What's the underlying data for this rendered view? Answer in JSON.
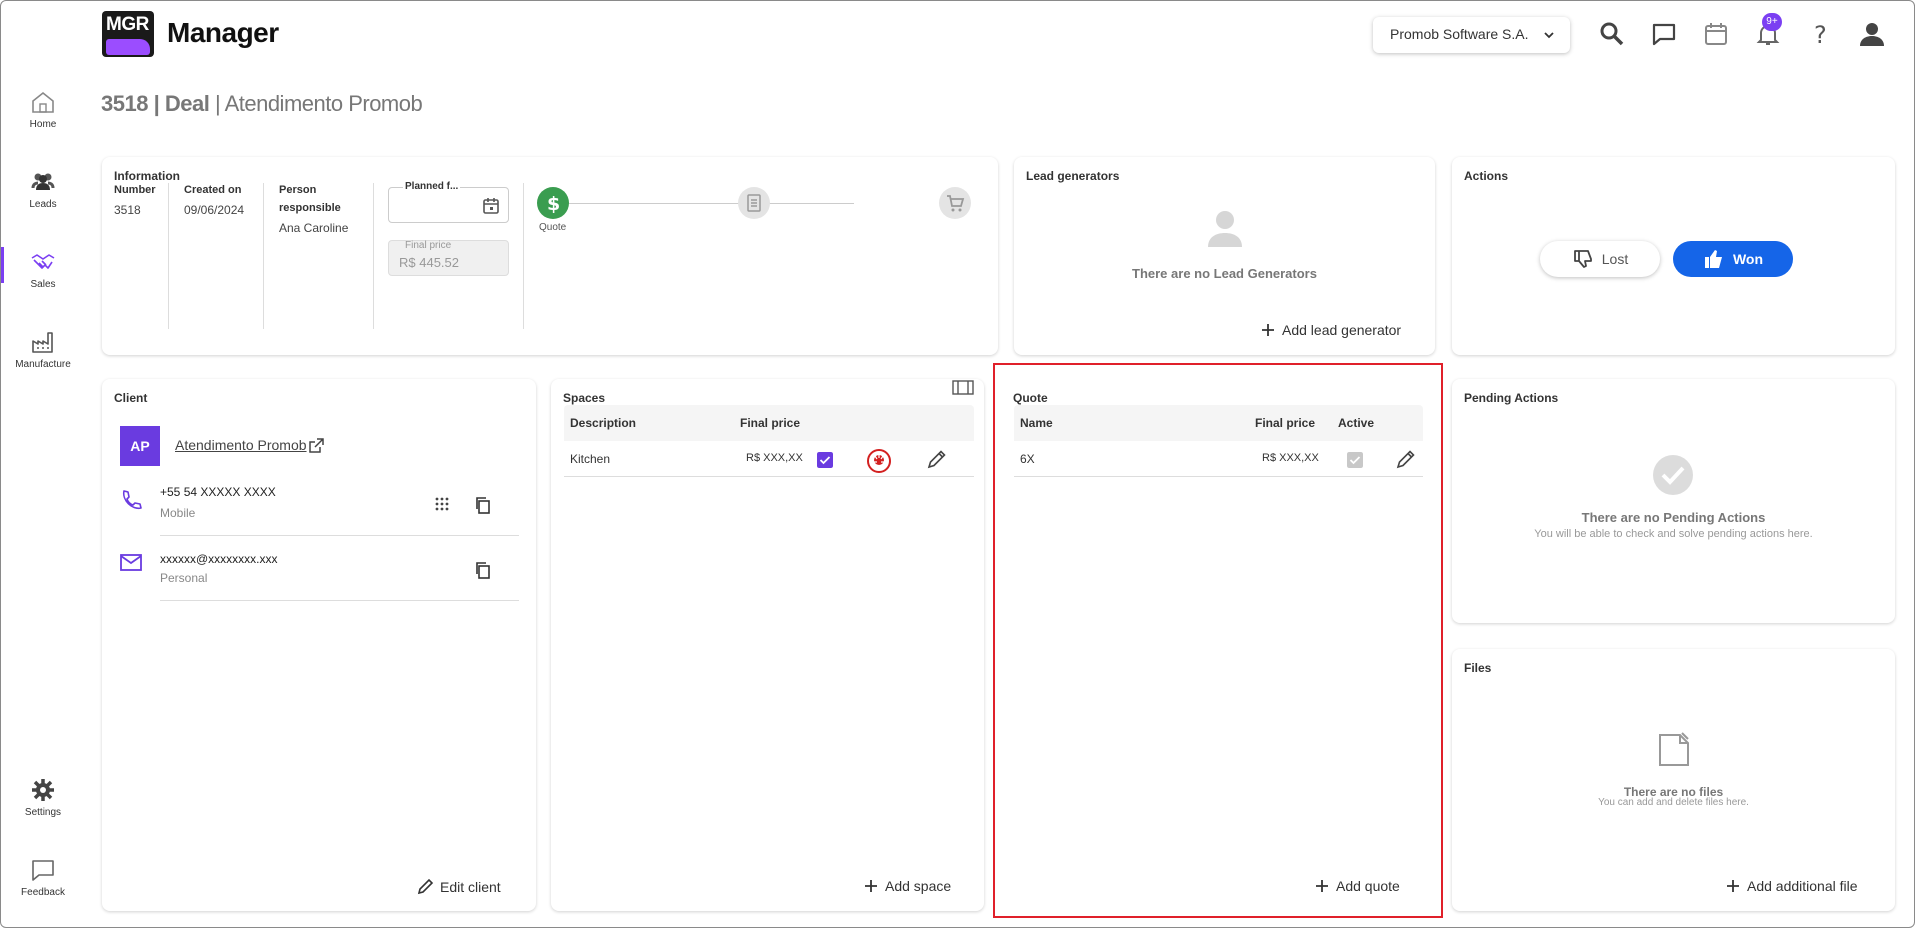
{
  "app": {
    "logo_text": "MGR",
    "title": "Manager"
  },
  "header": {
    "company": "Promob Software S.A.",
    "notification_count": "9+"
  },
  "nav": {
    "items": [
      {
        "label": "Home",
        "icon": "home-icon"
      },
      {
        "label": "Leads",
        "icon": "people-icon"
      },
      {
        "label": "Sales",
        "icon": "handshake-icon",
        "active": true
      },
      {
        "label": "Manufacture",
        "icon": "factory-icon"
      },
      {
        "label": "Settings",
        "icon": "gear-icon"
      },
      {
        "label": "Feedback",
        "icon": "feedback-icon"
      }
    ]
  },
  "page": {
    "number": "3518",
    "type": "Deal",
    "name": "Atendimento Promob"
  },
  "information": {
    "title": "Information",
    "number_label": "Number",
    "number": "3518",
    "created_label": "Created on",
    "created": "09/06/2024",
    "person_label": "Person responsible",
    "person": "Ana Caroline",
    "planned_label": "Planned f...",
    "final_price_label": "Final price",
    "final_price": "R$ 445.52",
    "steps": [
      {
        "label": "Quote",
        "icon": "dollar-icon",
        "done": true
      },
      {
        "label": "",
        "icon": "document-icon"
      },
      {
        "label": "",
        "icon": "cart-icon"
      }
    ]
  },
  "lead_generators": {
    "title": "Lead generators",
    "empty": "There are no Lead Generators",
    "add": "Add lead generator"
  },
  "actions": {
    "title": "Actions",
    "lost": "Lost",
    "won": "Won"
  },
  "client": {
    "title": "Client",
    "initials": "AP",
    "name": "Atendimento Promob",
    "phone": "+55 54 XXXXX XXXX",
    "phone_type": "Mobile",
    "email": "xxxxxx@xxxxxxxx.xxx",
    "email_type": "Personal",
    "edit": "Edit client"
  },
  "spaces": {
    "title": "Spaces",
    "headers": [
      "Description",
      "Final price"
    ],
    "rows": [
      {
        "description": "Kitchen",
        "price": "R$ XXX,XX",
        "checked": true
      }
    ],
    "add": "Add space"
  },
  "quote": {
    "title": "Quote",
    "headers": [
      "Name",
      "Final price",
      "Active"
    ],
    "rows": [
      {
        "name": "6X",
        "price": "R$ XXX,XX",
        "active": true
      }
    ],
    "add": "Add quote"
  },
  "pending": {
    "title": "Pending Actions",
    "empty": "There are no Pending Actions",
    "sub": "You will be able to check and solve pending actions here."
  },
  "files": {
    "title": "Files",
    "empty": "There are no files",
    "sub": "You can add and delete files here.",
    "add": "Add additional file"
  },
  "colors": {
    "accent": "#7b3ff2",
    "won": "#1565e8",
    "success": "#3a9d50",
    "highlight": "#e0202a"
  }
}
